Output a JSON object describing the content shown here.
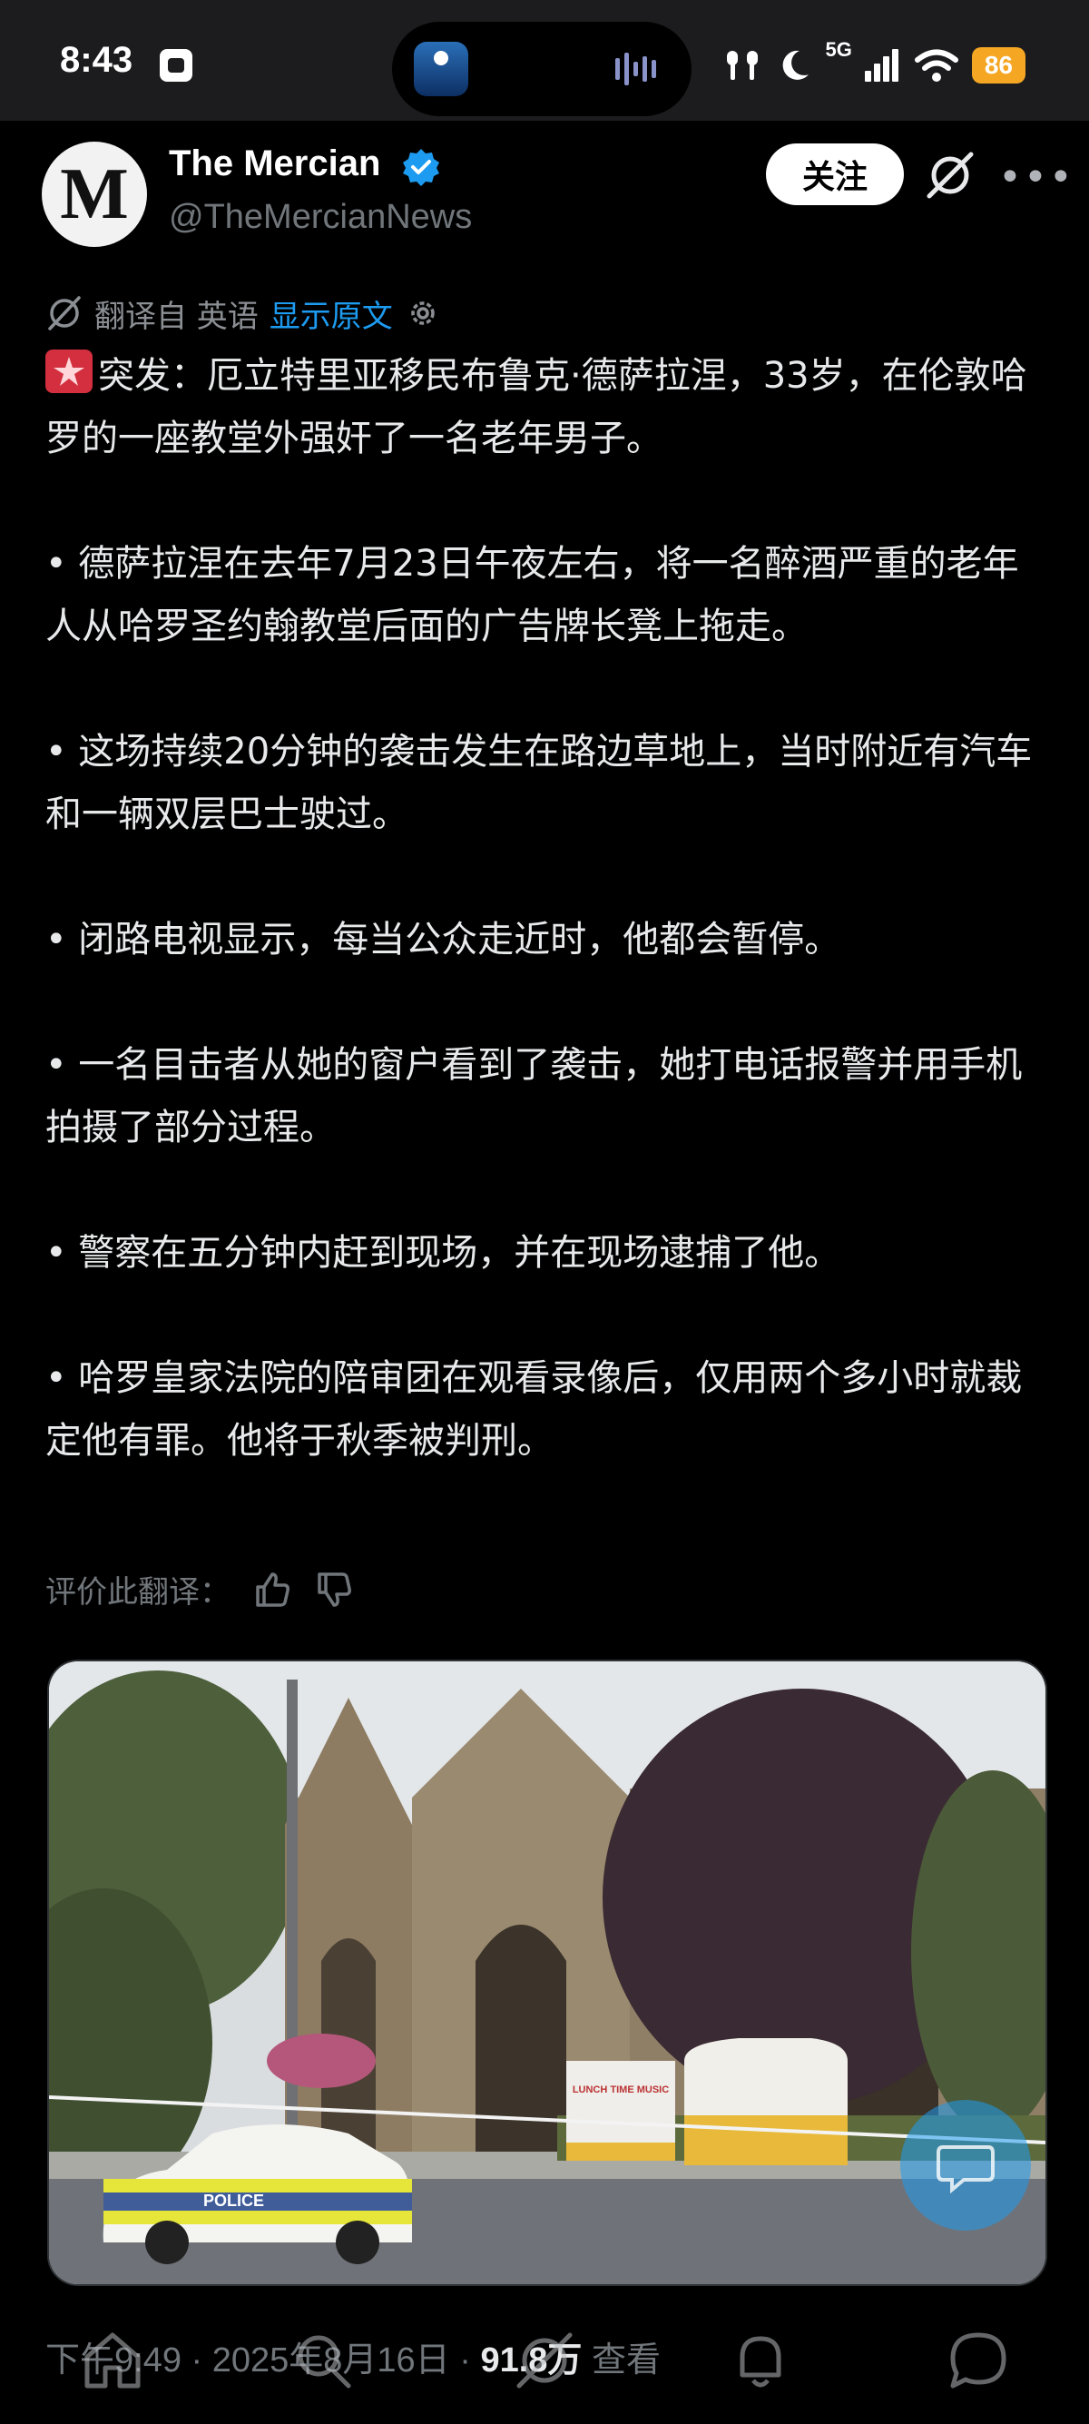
{
  "status_bar": {
    "time": "8:43",
    "network": "5G",
    "battery": "86"
  },
  "post": {
    "author_name": "The Mercian",
    "author_handle": "@TheMercianNews",
    "avatar_letter": "M",
    "follow_label": "关注",
    "translation": {
      "prefix": "翻译自 英语",
      "show_original": "显示原文"
    },
    "paragraphs": [
      "突发：厄立特里亚移民布鲁克·德萨拉涅，33岁，在伦敦哈罗的一座教堂外强奸了一名老年男子。",
      "• 德萨拉涅在去年7月23日午夜左右，将一名醉酒严重的老年人从哈罗圣约翰教堂后面的广告牌长凳上拖走。",
      "• 这场持续20分钟的袭击发生在路边草地上，当时附近有汽车和一辆双层巴士驶过。",
      "• 闭路电视显示，每当公众走近时，他都会暂停。",
      "• 一名目击者从她的窗户看到了袭击，她打电话报警并用手机拍摄了部分过程。",
      "• 警察在五分钟内赶到现场，并在现场逮捕了他。",
      "• 哈罗皇家法院的陪审团在观看录像后，仅用两个多小时就裁定他有罪。他将于秋季被判刑。"
    ],
    "rate_label": "评价此翻译：",
    "media": {
      "car_label": "POLICE",
      "sign_text": "LUNCH TIME MUSIC"
    },
    "meta": {
      "time_date": "下午9:49 · 2025年8月16日 · ",
      "views": "91.8万",
      "views_label": " 查看"
    }
  },
  "icons": {
    "verified": "verified-badge-icon",
    "grok": "grok-icon",
    "more": "more-icon",
    "translate": "translate-icon",
    "settings": "gear-icon",
    "thumbs_up": "thumbs-up-icon",
    "thumbs_down": "thumbs-down-icon",
    "tabs": [
      "home-icon",
      "search-icon",
      "grok-icon",
      "notifications-icon",
      "messages-icon"
    ]
  },
  "colors": {
    "accent": "#1d9bf0",
    "background": "#000000",
    "battery": "#f5a623"
  }
}
